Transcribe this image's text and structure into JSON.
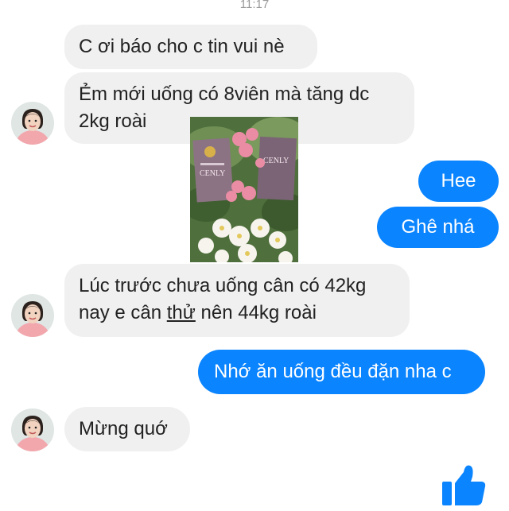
{
  "timestamp": "11:17",
  "colors": {
    "incoming_bubble": "#f0f0f1",
    "outgoing_bubble": "#0a84ff",
    "like_button": "#0a84ff"
  },
  "messages": [
    {
      "from": "contact",
      "lines": [
        "C ơi báo cho c tin vui nè"
      ]
    },
    {
      "from": "contact",
      "lines": [
        "Ẻm mới uống có 8viên mà tăng dc",
        "2kg roài"
      ]
    },
    {
      "from": "contact",
      "type": "image",
      "product_label": "CENLY"
    },
    {
      "from": "me",
      "lines": [
        "Hee"
      ]
    },
    {
      "from": "me",
      "lines": [
        "Ghê nhá"
      ]
    },
    {
      "from": "contact",
      "lines": [
        "Lúc trước chưa uống cân có 42kg"
      ],
      "line2": {
        "before": "nay e cân ",
        "underlined": "thử",
        "after": " nên 44kg roài"
      }
    },
    {
      "from": "me",
      "lines": [
        "Nhớ ăn uống đều đặn nha c"
      ]
    },
    {
      "from": "contact",
      "lines": [
        "Mừng quớ"
      ]
    }
  ],
  "icons": {
    "avatar": "contact-avatar",
    "like": "thumbs-up-icon"
  }
}
